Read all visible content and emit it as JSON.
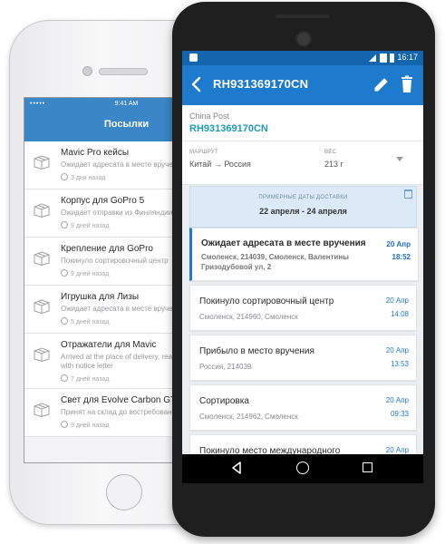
{
  "ios": {
    "status_time": "9:41 AM",
    "carrier": "•••••",
    "title": "Посылки",
    "items": [
      {
        "name": "Mavic Pro кейсы",
        "status": "Ожидает адресата в месте вручения",
        "ago": "3 дня назад"
      },
      {
        "name": "Корпус для GoPro 5",
        "status": "Ожидает отправки из Финляндии",
        "ago": "9 дней назад"
      },
      {
        "name": "Крепление для GoPro",
        "status": "Покинуло сортировочный центр",
        "ago": "9 дней назад"
      },
      {
        "name": "Игрушка для Лизы",
        "status": "Ожидает адресата в месте вручения",
        "ago": "5 дней назад"
      },
      {
        "name": "Отражатели для Mavic",
        "status": "Arrived at the place of delivery, ready for pick up with notice letter",
        "ago": "7 дней назад"
      },
      {
        "name": "Свет для Evolve Carbon GT",
        "status": "Принят на склад до востребования",
        "ago": "9 дней назад"
      }
    ]
  },
  "android": {
    "status_time": "16:17",
    "tracking_number": "RH931369170CN",
    "carrier": "China Post",
    "route_label": "МАРШРУТ",
    "route": "Китай → Россия",
    "weight_label": "ВЕС",
    "weight": "213 г",
    "dates_label": "ПРИМЕРНЫЕ ДАТЫ ДОСТАВКИ",
    "dates_range": "22 апреля - 24 апреля",
    "events": [
      {
        "title": "Ожидает адресата в месте вручения",
        "location": "Смоленск, 214039, Смоленск, Валентины Гризодубовой ул, 2",
        "date": "20 Апр",
        "time": "18:52"
      },
      {
        "title": "Покинуло сортировочный центр",
        "location": "Смоленск, 214960, Смоленск",
        "date": "20 Апр",
        "time": "14:08"
      },
      {
        "title": "Прибыло в место вручения",
        "location": "Россия, 214039",
        "date": "20 Апр",
        "time": "13:53"
      },
      {
        "title": "Сортировка",
        "location": "Смоленск, 214962, Смоленск",
        "date": "20 Апр",
        "time": "09:33"
      },
      {
        "title": "Покинуло место международного",
        "location": "",
        "date": "20 Апр",
        "time": ""
      }
    ]
  },
  "colors": {
    "ios_bar": "#3a86c6",
    "android_appbar": "#1e7acc",
    "android_status": "#1366ad",
    "tracking_accent": "#1e9bb0"
  }
}
